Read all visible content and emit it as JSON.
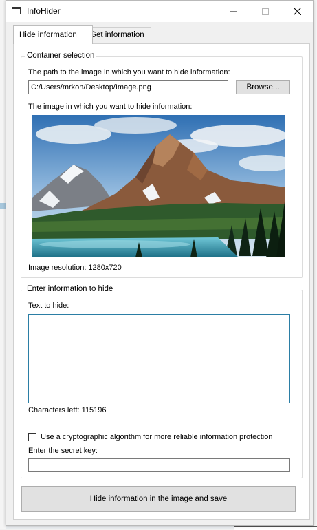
{
  "window": {
    "title": "InfoHider",
    "controls": {
      "minimize": "—",
      "maximize": "☐",
      "close": "✕"
    }
  },
  "tabs": [
    {
      "label": "Hide information",
      "active": true
    },
    {
      "label": "Get information",
      "active": false
    }
  ],
  "container_selection": {
    "group_title": "Container selection",
    "path_label": "The path to the image in which you want to hide information:",
    "path_value": "C:/Users/mrkon/Desktop/Image.png",
    "browse_label": "Browse...",
    "image_label": "The image in which you want to hide information:",
    "image_description": "mountain-lake-landscape",
    "resolution_text": "Image resolution: 1280x720"
  },
  "info_to_hide": {
    "group_title": "Enter information to hide",
    "text_label": "Text to hide:",
    "text_value": "",
    "chars_left_text": "Characters left: 115196",
    "crypto_checkbox_label": "Use a cryptographic algorithm for more reliable information protection",
    "crypto_checked": false,
    "secret_key_label": "Enter the secret key:",
    "secret_key_value": ""
  },
  "actions": {
    "hide_save_label": "Hide information in the image and save"
  },
  "colors": {
    "focus_border": "#2b7ea5",
    "window_bg": "#f0f0f0",
    "panel_bg": "#ffffff"
  }
}
